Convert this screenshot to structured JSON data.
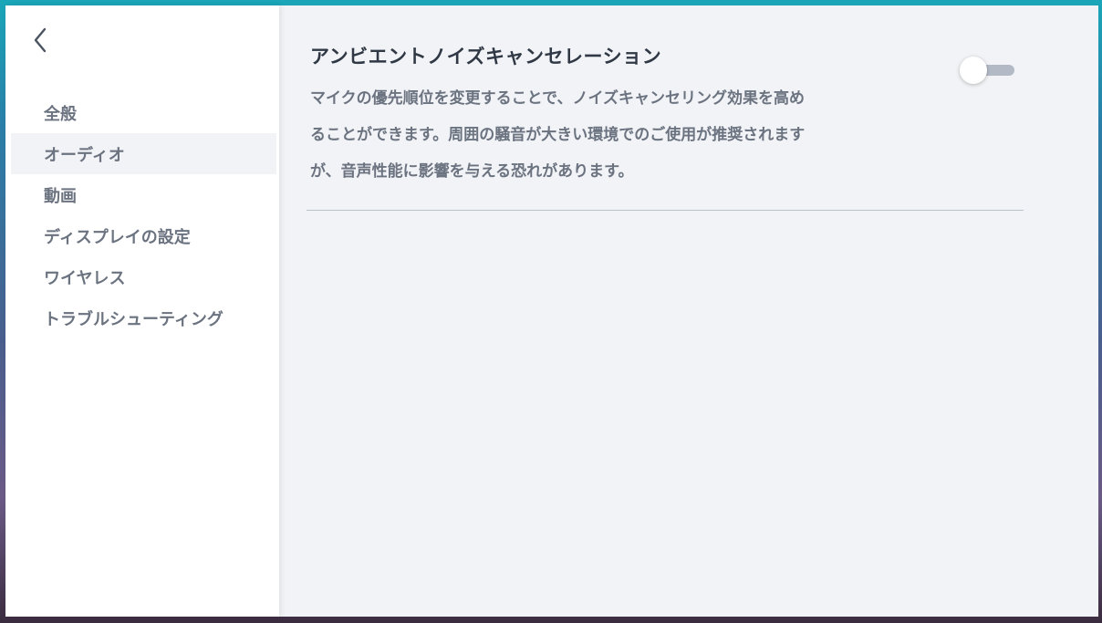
{
  "sidebar": {
    "items": [
      {
        "label": "全般"
      },
      {
        "label": "オーディオ"
      },
      {
        "label": "動画"
      },
      {
        "label": "ディスプレイの設定"
      },
      {
        "label": "ワイヤレス"
      },
      {
        "label": "トラブルシューティング"
      }
    ],
    "active": "オーディオ"
  },
  "setting": {
    "title": "アンビエントノイズキャンセレーション",
    "description_lines": [
      "マイクの優先順位を変更することで、ノイズキャンセリング効果を高め",
      "ることができます。周囲の騒音が大きい環境でのご使用が推奨されます",
      "が、音声性能に影響を与える恐れがあります。"
    ],
    "toggle_on": false
  },
  "colors": {
    "accent_track_off": "#b3bac6",
    "sidebar_bg": "#ffffff",
    "content_bg": "#f2f3f6"
  }
}
